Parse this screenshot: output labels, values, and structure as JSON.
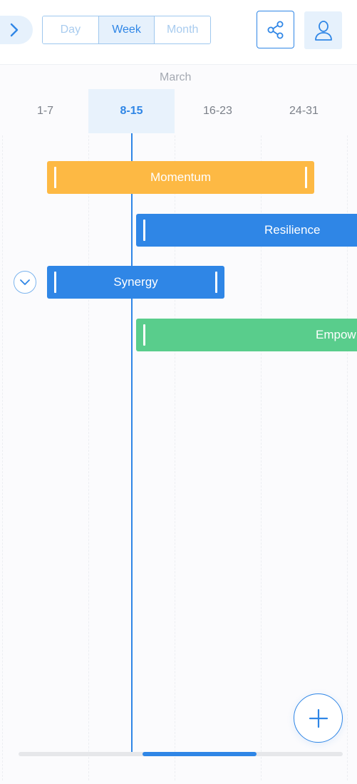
{
  "toolbar": {
    "expand_icon": "chevron-right-icon",
    "views": [
      {
        "label": "Day",
        "active": false
      },
      {
        "label": "Week",
        "active": true
      },
      {
        "label": "Month",
        "active": false
      }
    ],
    "share_icon": "share-icon",
    "user_icon": "user-icon"
  },
  "timeline": {
    "month": "March",
    "weeks": [
      "1-7",
      "8-15",
      "16-23",
      "24-31"
    ],
    "current_week": "8-15"
  },
  "tasks": [
    {
      "label": "Momentum",
      "color": "#fdb944"
    },
    {
      "label": "Resilience",
      "color": "#2f86e6"
    },
    {
      "label": "Synergy",
      "color": "#2f86e6"
    },
    {
      "label": "Empow",
      "color": "#59cd8c"
    }
  ],
  "controls": {
    "collapse_icon": "chevron-down-icon",
    "add_icon": "plus-icon"
  },
  "colors": {
    "accent": "#2f86e6",
    "accent_light": "#e6f1fc"
  }
}
